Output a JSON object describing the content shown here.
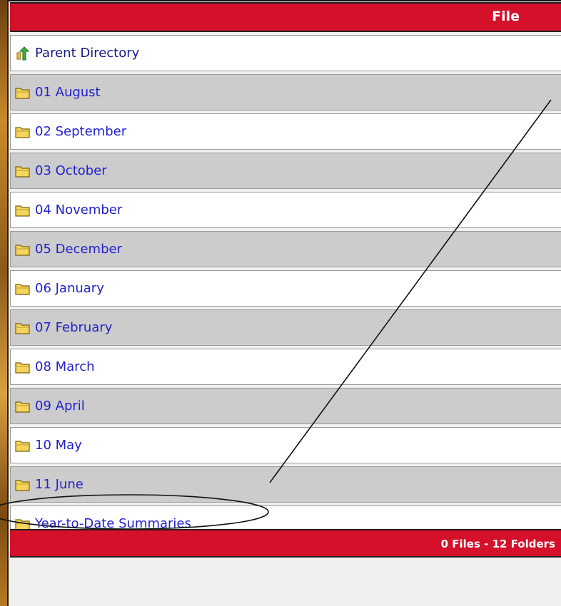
{
  "header": {
    "title": "File"
  },
  "entries": [
    {
      "label": "Parent Directory",
      "icon": "parent-directory-icon"
    },
    {
      "label": "01 August",
      "icon": "folder-icon"
    },
    {
      "label": "02 September",
      "icon": "folder-icon"
    },
    {
      "label": "03 October",
      "icon": "folder-icon"
    },
    {
      "label": "04 November",
      "icon": "folder-icon"
    },
    {
      "label": "05 December",
      "icon": "folder-icon"
    },
    {
      "label": "06 January",
      "icon": "folder-icon"
    },
    {
      "label": "07 February",
      "icon": "folder-icon"
    },
    {
      "label": "08 March",
      "icon": "folder-icon"
    },
    {
      "label": "09 April",
      "icon": "folder-icon"
    },
    {
      "label": "10 May",
      "icon": "folder-icon"
    },
    {
      "label": "11 June",
      "icon": "folder-icon"
    },
    {
      "label": "Year-to-Date Summaries",
      "icon": "folder-icon"
    }
  ],
  "footer": {
    "status": "0 Files - 12 Folders"
  },
  "colors": {
    "header_red": "#d4102a",
    "link_blue": "#2222cc",
    "row_grey": "#cccccc",
    "row_white": "#ffffff"
  }
}
